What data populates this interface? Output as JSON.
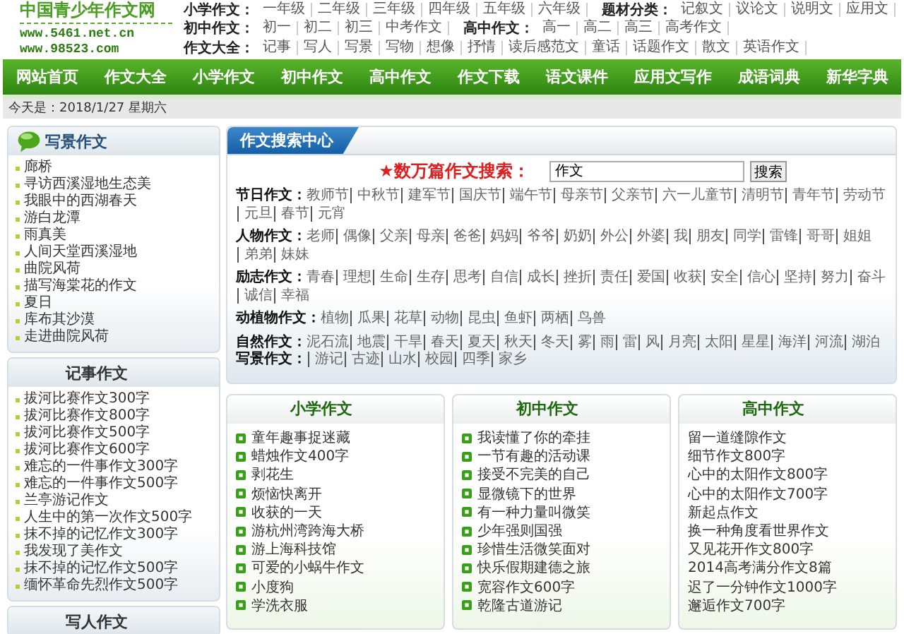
{
  "header": {
    "logo": {
      "title": "中国青少年作文网",
      "urls": [
        "www.5461.net.cn",
        "www.98523.com"
      ]
    },
    "rows": [
      [
        {
          "label": "小学作文：",
          "links": [
            "一年级",
            "二年级",
            "三年级",
            "四年级",
            "五年级",
            "六年级"
          ]
        },
        {
          "label": "题材分类：",
          "links": [
            "记叙文",
            "议论文",
            "说明文",
            "应用文"
          ]
        }
      ],
      [
        {
          "label": "初中作文：",
          "links": [
            "初一",
            "初二",
            "初三",
            "中考作文"
          ]
        },
        {
          "label": "高中作文：",
          "links": [
            "高一",
            "高二",
            "高三",
            "高考作文"
          ]
        }
      ],
      [
        {
          "label": "作文大全：",
          "links": [
            "记事",
            "写人",
            "写景",
            "写物",
            "想像",
            "抒情",
            "读后感范文",
            "童话",
            "话题作文",
            "散文",
            "英语作文"
          ]
        }
      ]
    ]
  },
  "nav": [
    "网站首页",
    "作文大全",
    "小学作文",
    "初中作文",
    "高中作文",
    "作文下载",
    "语文课件",
    "应用文写作",
    "成语词典",
    "新华字典"
  ],
  "date": "今天是：2018/1/27 星期六",
  "sidebar": [
    {
      "title": "写景作文",
      "kind": "icon-title",
      "items": [
        "廊桥",
        "寻访西溪湿地生态美",
        "我眼中的西湖春天",
        "游白龙潭",
        "雨真美",
        "人间天堂西溪湿地",
        "曲院风荷",
        "描写海棠花的作文",
        "夏日",
        "库布其沙漠",
        "走进曲院风荷"
      ]
    },
    {
      "title": "记事作文",
      "kind": "plain-title",
      "items": [
        "拔河比赛作文300字",
        "拔河比赛作文800字",
        "拔河比赛作文500字",
        "拔河比赛作文600字",
        "难忘的一件事作文300字",
        "难忘的一件事作文500字",
        "兰亭游记作文",
        "人生中的第一次作文500字",
        "抹不掉的记忆作文300字",
        "我发现了美作文",
        "抹不掉的记忆作文500字",
        "缅怀革命先烈作文500字"
      ]
    },
    {
      "title": "写人作文",
      "kind": "plain-title"
    }
  ],
  "search": {
    "title": "作文搜索中心",
    "label": "★数万篇作文搜索：",
    "value": "作文",
    "button": "搜索",
    "categories": [
      [
        {
          "label": "节日作文：",
          "links": [
            "教师节",
            "中秋节",
            "建军节",
            "国庆节",
            "端午节",
            "母亲节",
            "父亲节",
            "六一儿童节",
            "清明节",
            "青年节",
            "劳动节",
            "元旦",
            "春节",
            "元宵"
          ]
        }
      ],
      [
        {
          "label": "人物作文：",
          "links": [
            "老师",
            "偶像",
            "父亲",
            "母亲",
            "爸爸",
            "妈妈",
            "爷爷",
            "奶奶",
            "外公",
            "外婆",
            "我",
            "朋友",
            "同学",
            "雷锋",
            "哥哥",
            "姐姐",
            "弟弟",
            "妹妹"
          ]
        }
      ],
      [
        {
          "label": "励志作文：",
          "links": [
            "青春",
            "理想",
            "生命",
            "生存",
            "思考",
            "自信",
            "成长",
            "挫折",
            "责任",
            "爱国",
            "收获",
            "安全",
            "信心",
            "坚持",
            "努力",
            "奋斗",
            "诚信",
            "幸福"
          ]
        }
      ],
      [
        {
          "label": "动植物作文：",
          "links": [
            "植物",
            "瓜果",
            "花草",
            "动物",
            "昆虫",
            "鱼虾",
            "两栖",
            "鸟兽"
          ]
        }
      ],
      [
        {
          "label": "自然作文：",
          "links": [
            "泥石流",
            "地震",
            "干旱",
            "春天",
            "夏天",
            "秋天",
            "冬天",
            "雾",
            "雨",
            "雷",
            "风",
            "月亮",
            "太阳",
            "星星",
            "海洋",
            "河流",
            "湖泊"
          ]
        },
        {
          "label": "写景作文：",
          "links": [
            "游记",
            "古迹",
            "山水",
            "校园",
            "四季",
            "家乡"
          ]
        }
      ]
    ]
  },
  "boxes": [
    {
      "title": "小学作文",
      "kind": "icon-list",
      "items": [
        "童年趣事捉迷藏",
        "蜡烛作文400字",
        "剥花生",
        "烦恼快离开",
        "收获的一天",
        "游杭州湾跨海大桥",
        "游上海科技馆",
        "可爱的小蜗牛作文",
        "小度狗",
        "学洗衣服"
      ]
    },
    {
      "title": "初中作文",
      "kind": "icon-list",
      "items": [
        "我读懂了你的牵挂",
        "一节有趣的活动课",
        "接受不完美的自己",
        "显微镜下的世界",
        "有一种力量叫微笑",
        "少年强则国强",
        "珍惜生活微笑面对",
        "快乐假期建德之旅",
        "宽容作文600字",
        "乾隆古道游记"
      ]
    },
    {
      "title": "高中作文",
      "kind": "plain-list",
      "items": [
        "留一道缝隙作文",
        "细节作文800字",
        "心中的太阳作文800字",
        "心中的太阳作文700字",
        "新起点作文",
        "换一种角度看世界作文",
        "又见花开作文800字",
        "2014高考满分作文8篇",
        "迟了一分钟作文1000字",
        "邂逅作文700字"
      ]
    }
  ]
}
